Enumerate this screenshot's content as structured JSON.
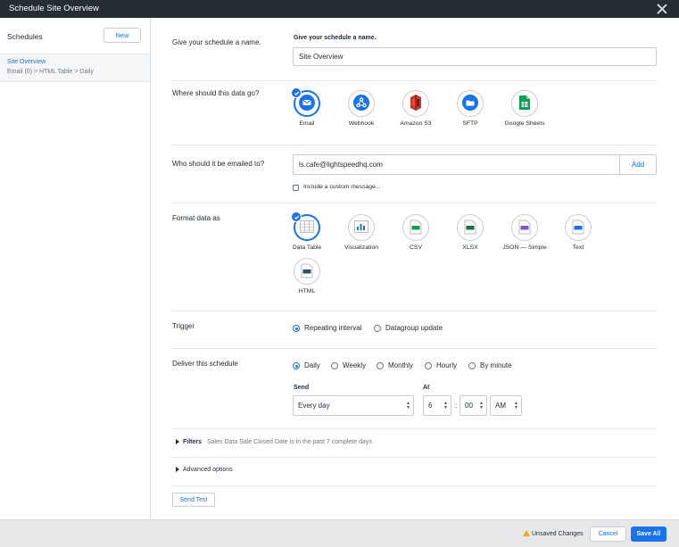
{
  "window": {
    "title": "Schedule Site Overview",
    "close_icon": "close-icon"
  },
  "sidebar": {
    "heading": "Schedules",
    "new_label": "New",
    "item": {
      "name": "Site Overview",
      "detail": "Email (0) > HTML Table > Daily"
    }
  },
  "name_section": {
    "label": "Give your schedule a name.",
    "field_label": "Give your schedule a name.",
    "value": "Site Overview"
  },
  "destination_section": {
    "label": "Where should this data go?",
    "options": [
      {
        "label": "Email",
        "icon": "email-icon",
        "selected": true
      },
      {
        "label": "Webhook",
        "icon": "webhook-icon",
        "selected": false
      },
      {
        "label": "Amazon S3",
        "icon": "amazon-s3-icon",
        "selected": false
      },
      {
        "label": "SFTP",
        "icon": "sftp-icon",
        "selected": false
      },
      {
        "label": "Google Sheets",
        "icon": "google-sheets-icon",
        "selected": false
      }
    ]
  },
  "email_section": {
    "label": "Who should it be emailed to?",
    "value": "ls.cafe@lightspeedhq.com",
    "add_label": "Add",
    "custom_message_label": "Include a custom message..."
  },
  "format_section": {
    "label": "Format data as",
    "options": [
      {
        "label": "Data Table",
        "icon": "data-table-icon",
        "selected": true
      },
      {
        "label": "Visualization",
        "icon": "visualization-icon",
        "selected": false
      },
      {
        "label": "CSV",
        "icon": "csv-icon",
        "tag": "CSV",
        "selected": false
      },
      {
        "label": "XLSX",
        "icon": "xlsx-icon",
        "tag": "XLSX",
        "selected": false
      },
      {
        "label": "JSON — Simple",
        "icon": "json-icon",
        "tag": "JSON",
        "selected": false
      },
      {
        "label": "Text",
        "icon": "text-icon",
        "tag": "TXT",
        "selected": false
      },
      {
        "label": "HTML",
        "icon": "html-icon",
        "tag": "HTML",
        "selected": false
      }
    ]
  },
  "trigger_section": {
    "label": "Trigger",
    "options": [
      {
        "label": "Repeating interval",
        "selected": true
      },
      {
        "label": "Datagroup update",
        "selected": false
      }
    ]
  },
  "deliver_section": {
    "label": "Deliver this schedule",
    "options": [
      {
        "label": "Daily",
        "selected": true
      },
      {
        "label": "Weekly",
        "selected": false
      },
      {
        "label": "Monthly",
        "selected": false
      },
      {
        "label": "Hourly",
        "selected": false
      },
      {
        "label": "By minute",
        "selected": false
      }
    ],
    "send_label": "Send",
    "send_value": "Every day",
    "at_label": "At",
    "hour": "6",
    "minute": "00",
    "ampm": "AM"
  },
  "filters": {
    "label": "Filters",
    "summary_muted": "Sales Data Sale Closed Date",
    "summary_rest": "is in the past 7 complete days"
  },
  "advanced": {
    "label": "Advanced options"
  },
  "send_test_label": "Send Test",
  "footer": {
    "unsaved": "Unsaved Changes",
    "cancel": "Cancel",
    "save_all": "Save All"
  },
  "colors": {
    "accent": "#1a73e8",
    "titlebar": "#262d33",
    "warning": "#f5a623"
  }
}
